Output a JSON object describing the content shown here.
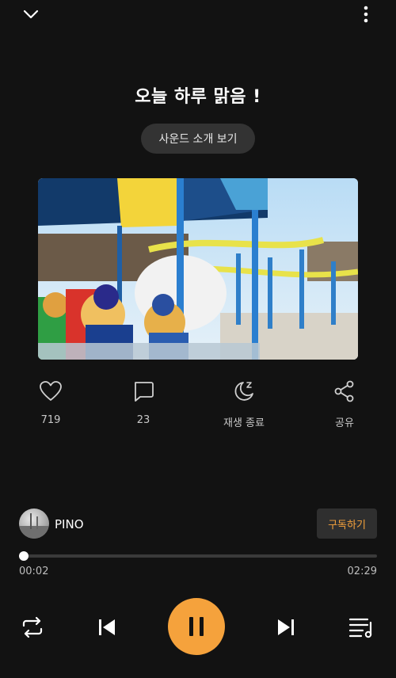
{
  "player": {
    "title": "오늘 하루 맑음 !",
    "intro_button": "사운드 소개 보기",
    "cover_image": "amusement-park-carousel-photo"
  },
  "actions": [
    {
      "icon": "heart-icon",
      "label": "719"
    },
    {
      "icon": "comment-icon",
      "label": "23"
    },
    {
      "icon": "sleep-timer-icon",
      "label": "재생 종료"
    },
    {
      "icon": "share-icon",
      "label": "공유"
    }
  ],
  "channel": {
    "name": "PINO",
    "subscribe_label": "구독하기"
  },
  "progress": {
    "current": "00:02",
    "total": "02:29",
    "fraction": 0.014
  },
  "colors": {
    "accent": "#f5a23c",
    "background": "#121212"
  }
}
